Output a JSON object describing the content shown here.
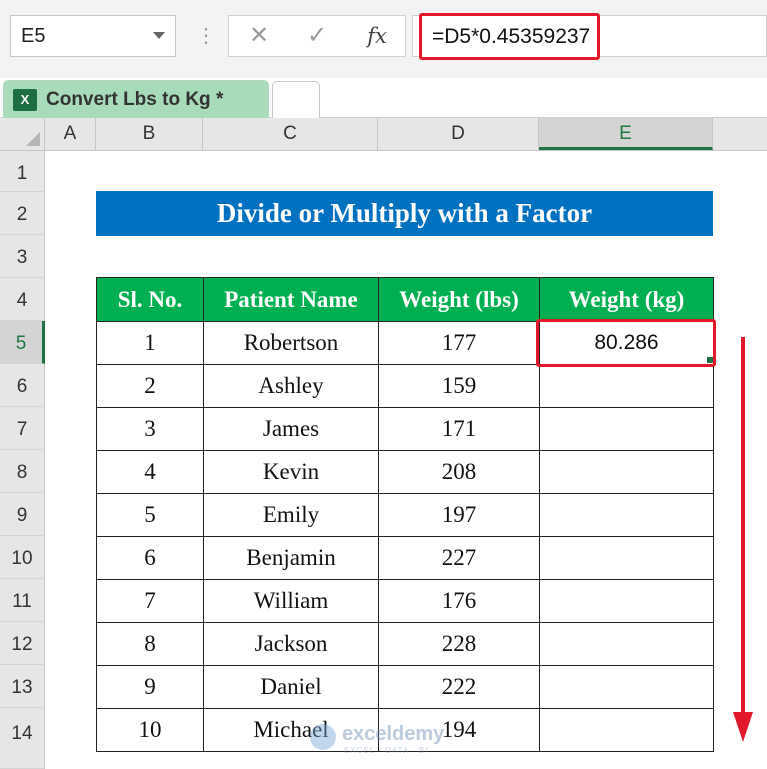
{
  "formula_bar": {
    "name_box": "E5",
    "dots": "⋮",
    "cancel_glyph": "✕",
    "enter_glyph": "✓",
    "fx_label": "fx",
    "formula": "=D5*0.45359237"
  },
  "tabs": {
    "active_label": "Convert Lbs to Kg *",
    "icon_label": "X"
  },
  "columns": [
    "A",
    "B",
    "C",
    "D",
    "E"
  ],
  "rows": [
    "1",
    "2",
    "3",
    "4",
    "5",
    "6",
    "7",
    "8",
    "9",
    "10",
    "11",
    "12",
    "13",
    "14"
  ],
  "title": "Divide or Multiply with a Factor",
  "table": {
    "headers": [
      "Sl. No.",
      "Patient Name",
      "Weight (lbs)",
      "Weight (kg)"
    ],
    "rows": [
      [
        "1",
        "Robertson",
        "177",
        "80.286"
      ],
      [
        "2",
        "Ashley",
        "159",
        ""
      ],
      [
        "3",
        "James",
        "171",
        ""
      ],
      [
        "4",
        "Kevin",
        "208",
        ""
      ],
      [
        "5",
        "Emily",
        "197",
        ""
      ],
      [
        "6",
        "Benjamin",
        "227",
        ""
      ],
      [
        "7",
        "William",
        "176",
        ""
      ],
      [
        "8",
        "Jackson",
        "228",
        ""
      ],
      [
        "9",
        "Daniel",
        "222",
        ""
      ],
      [
        "10",
        "Michael",
        "194",
        ""
      ]
    ]
  },
  "watermark": {
    "name": "exceldemy",
    "tagline": "EXCEL · DATA · BI"
  },
  "colors": {
    "highlight": "#e3192b",
    "header_green": "#00b050",
    "title_blue": "#0070c0",
    "excel_green": "#217346"
  }
}
